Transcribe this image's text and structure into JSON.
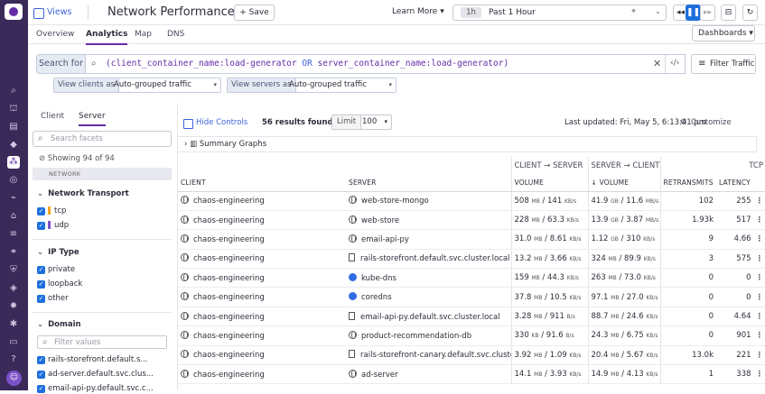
{
  "header": {
    "views_label": "Views",
    "title": "Network Performance",
    "save_label": "Save",
    "learn_more": "Learn More",
    "time_short": "1h",
    "time_range": "Past 1 Hour"
  },
  "tabs": [
    "Overview",
    "Analytics",
    "Map",
    "DNS"
  ],
  "dashboards_label": "Dashboards",
  "search": {
    "label": "Search for",
    "query_a": "(client_container_name:load-generator",
    "query_op": "OR",
    "query_b": "server_container_name:load-generator)",
    "filter_traffic": "Filter Traffic"
  },
  "view_clients": {
    "label": "View clients as",
    "value": "Auto-grouped traffic"
  },
  "view_servers": {
    "label": "View servers as",
    "value": "Auto-grouped traffic"
  },
  "facets": {
    "tab_client": "Client",
    "tab_server": "Server",
    "search_placeholder": "Search facets",
    "showing": "Showing 94 of 94",
    "network_section": "NETWORK",
    "network_transport": "Network Transport",
    "transport_items": [
      {
        "label": "tcp",
        "color": "#f5a623"
      },
      {
        "label": "udp",
        "color": "#7c52c8"
      }
    ],
    "ip_type": "IP Type",
    "ip_items": [
      "private",
      "loopback",
      "other"
    ],
    "domain": "Domain",
    "filter_values": "Filter values",
    "domain_items": [
      "rails-storefront.default.s...",
      "ad-server.default.svc.clus...",
      "email-api-py.default.svc.c..."
    ]
  },
  "toolbar": {
    "hide_controls": "Hide Controls",
    "results": "56 results found",
    "limit_label": "Limit",
    "limit_value": "100",
    "last_updated": "Last updated: Fri, May 5, 6:13:41 pm",
    "customize": "Customize",
    "summary_graphs": "Summary Graphs"
  },
  "table": {
    "group_c2s": "CLIENT → SERVER",
    "group_s2c": "SERVER → CLIENT",
    "group_tcp": "TCP",
    "headers": {
      "client": "CLIENT",
      "server": "SERVER",
      "volume": "VOLUME",
      "volume_sorted": "↓ VOLUME",
      "retransmits": "RETRANSMITS",
      "latency": "LATENCY"
    },
    "rows": [
      {
        "client": "chaos-engineering",
        "server": "web-store-mongo",
        "server_icon": "globe-icon",
        "c2s_a": "508",
        "c2s_a_u": "MB",
        "c2s_b": "141",
        "c2s_b_u": "KB/s",
        "s2c_a": "41.9",
        "s2c_a_u": "GB",
        "s2c_b": "11.6",
        "s2c_b_u": "MB/s",
        "retransmits": "102",
        "latency": "255"
      },
      {
        "client": "chaos-engineering",
        "server": "web-store",
        "server_icon": "globe-icon",
        "c2s_a": "228",
        "c2s_a_u": "MB",
        "c2s_b": "63.3",
        "c2s_b_u": "KB/s",
        "s2c_a": "13.9",
        "s2c_a_u": "GB",
        "s2c_b": "3.87",
        "s2c_b_u": "MB/s",
        "retransmits": "1.93k",
        "latency": "517"
      },
      {
        "client": "chaos-engineering",
        "server": "email-api-py",
        "server_icon": "globe-icon",
        "c2s_a": "31.0",
        "c2s_a_u": "MB",
        "c2s_b": "8.61",
        "c2s_b_u": "KB/s",
        "s2c_a": "1.12",
        "s2c_a_u": "GB",
        "s2c_b": "310",
        "s2c_b_u": "KB/s",
        "retransmits": "9",
        "latency": "4.66"
      },
      {
        "client": "chaos-engineering",
        "server": "rails-storefront.default.svc.cluster.local",
        "server_icon": "doc-icon",
        "c2s_a": "13.2",
        "c2s_a_u": "MB",
        "c2s_b": "3.66",
        "c2s_b_u": "KB/s",
        "s2c_a": "324",
        "s2c_a_u": "MB",
        "s2c_b": "89.9",
        "s2c_b_u": "KB/s",
        "retransmits": "3",
        "latency": "575"
      },
      {
        "client": "chaos-engineering",
        "server": "kube-dns",
        "server_icon": "k8s-icon",
        "c2s_a": "159",
        "c2s_a_u": "MB",
        "c2s_b": "44.3",
        "c2s_b_u": "KB/s",
        "s2c_a": "263",
        "s2c_a_u": "MB",
        "s2c_b": "73.0",
        "s2c_b_u": "KB/s",
        "retransmits": "0",
        "latency": "0"
      },
      {
        "client": "chaos-engineering",
        "server": "coredns",
        "server_icon": "k8s-icon",
        "c2s_a": "37.8",
        "c2s_a_u": "MB",
        "c2s_b": "10.5",
        "c2s_b_u": "KB/s",
        "s2c_a": "97.1",
        "s2c_a_u": "MB",
        "s2c_b": "27.0",
        "s2c_b_u": "KB/s",
        "retransmits": "0",
        "latency": "0"
      },
      {
        "client": "chaos-engineering",
        "server": "email-api-py.default.svc.cluster.local",
        "server_icon": "doc-icon",
        "c2s_a": "3.28",
        "c2s_a_u": "MB",
        "c2s_b": "911",
        "c2s_b_u": "B/s",
        "s2c_a": "88.7",
        "s2c_a_u": "MB",
        "s2c_b": "24.6",
        "s2c_b_u": "KB/s",
        "retransmits": "0",
        "latency": "4.64"
      },
      {
        "client": "chaos-engineering",
        "server": "product-recommendation-db",
        "server_icon": "globe-icon",
        "c2s_a": "330",
        "c2s_a_u": "KB",
        "c2s_b": "91.6",
        "c2s_b_u": "B/s",
        "s2c_a": "24.3",
        "s2c_a_u": "MB",
        "s2c_b": "6.75",
        "s2c_b_u": "KB/s",
        "retransmits": "0",
        "latency": "901"
      },
      {
        "client": "chaos-engineering",
        "server": "rails-storefront-canary.default.svc.cluster.l",
        "server_icon": "doc-icon",
        "c2s_a": "3.92",
        "c2s_a_u": "MB",
        "c2s_b": "1.09",
        "c2s_b_u": "KB/s",
        "s2c_a": "20.4",
        "s2c_a_u": "MB",
        "s2c_b": "5.67",
        "s2c_b_u": "KB/s",
        "retransmits": "13.0k",
        "latency": "221"
      },
      {
        "client": "chaos-engineering",
        "server": "ad-server",
        "server_icon": "globe-icon",
        "c2s_a": "14.1",
        "c2s_a_u": "MB",
        "c2s_b": "3.93",
        "c2s_b_u": "KB/s",
        "s2c_a": "14.9",
        "s2c_a_u": "MB",
        "s2c_b": "4.13",
        "s2c_b_u": "KB/s",
        "retransmits": "1",
        "latency": "338"
      }
    ]
  }
}
